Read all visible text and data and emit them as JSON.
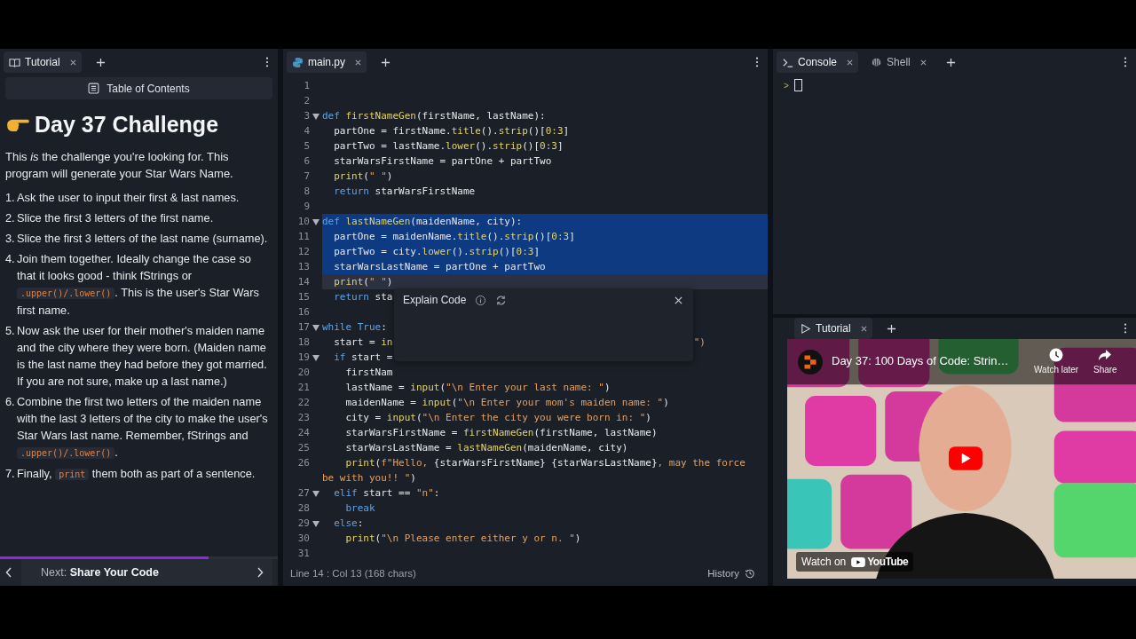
{
  "tutorial_pane": {
    "tab": {
      "label": "Tutorial",
      "selected": true
    },
    "toc_button": "Table of Contents",
    "heading": "Day 37 Challenge",
    "intro": "This *is* the challenge you're looking for. This program will generate your Star Wars Name.",
    "steps": [
      {
        "number": "1.",
        "parts": [
          {
            "kind": "text",
            "text": "Ask the user to input their first & last names."
          }
        ]
      },
      {
        "number": "2.",
        "parts": [
          {
            "kind": "text",
            "text": "Slice the first 3 letters of the first name."
          }
        ]
      },
      {
        "number": "3.",
        "parts": [
          {
            "kind": "text",
            "text": "Slice the first 3 letters of the last name (surname)."
          }
        ]
      },
      {
        "number": "4.",
        "parts": [
          {
            "kind": "text",
            "text": "Join them together. Ideally change the case so that it looks good - think fStrings or "
          },
          {
            "kind": "code",
            "text": ".upper()/.lower()"
          },
          {
            "kind": "text",
            "text": ". This is the user's Star Wars first name."
          }
        ]
      },
      {
        "number": "5.",
        "parts": [
          {
            "kind": "text",
            "text": "Now ask the user for their mother's maiden name and the city where they were born. (Maiden name is the last name they had before they got married. If you are not sure, make up a last name.)"
          }
        ]
      },
      {
        "number": "6.",
        "parts": [
          {
            "kind": "text",
            "text": "Combine the first two letters of the maiden name with the last 3 letters of the city to make the user's Star Wars last name. Remember, fStrings and "
          },
          {
            "kind": "code",
            "text": ".upper()/.lower()"
          },
          {
            "kind": "text",
            "text": "."
          }
        ]
      },
      {
        "number": "7.",
        "parts": [
          {
            "kind": "text",
            "text": "Finally, "
          },
          {
            "kind": "code",
            "text": "print"
          },
          {
            "kind": "text",
            "text": " them both as part of a sentence."
          }
        ]
      }
    ],
    "progress": {
      "level": 0.75
    },
    "next": {
      "prefix": "Next:",
      "title": "Share Your Code"
    }
  },
  "editor": {
    "tab": {
      "label": "main.py",
      "selected": true
    },
    "lines": [
      {
        "number": "1"
      },
      {
        "number": "2"
      },
      {
        "number": "3",
        "fold": true,
        "selected": false,
        "current": false,
        "tokens": [
          {
            "kind": "kw",
            "text": "def"
          },
          {
            "kind": "fn",
            "text": " firstNameGen"
          },
          {
            "kind": "plain",
            "text": "(firstName, lastName):"
          }
        ]
      },
      {
        "number": "4",
        "fold": false,
        "selected": false,
        "current": false,
        "tokens": [
          {
            "kind": "plain",
            "text": "  partOne = firstName."
          },
          {
            "kind": "fn",
            "text": "title"
          },
          {
            "kind": "plain",
            "text": "()."
          },
          {
            "kind": "fn",
            "text": "strip"
          },
          {
            "kind": "plain",
            "text": "()["
          },
          {
            "kind": "num",
            "text": "0:3"
          },
          {
            "kind": "plain",
            "text": "]"
          }
        ]
      },
      {
        "number": "5",
        "fold": false,
        "selected": false,
        "current": false,
        "tokens": [
          {
            "kind": "plain",
            "text": "  partTwo = lastName."
          },
          {
            "kind": "fn",
            "text": "lower"
          },
          {
            "kind": "plain",
            "text": "()."
          },
          {
            "kind": "fn",
            "text": "strip"
          },
          {
            "kind": "plain",
            "text": "()["
          },
          {
            "kind": "num",
            "text": "0:3"
          },
          {
            "kind": "plain",
            "text": "]"
          }
        ]
      },
      {
        "number": "6",
        "fold": false,
        "selected": false,
        "current": false,
        "tokens": [
          {
            "kind": "plain",
            "text": "  starWarsFirstName = partOne + partTwo"
          }
        ]
      },
      {
        "number": "7",
        "fold": false,
        "selected": false,
        "current": false,
        "tokens": [
          {
            "kind": "fn",
            "text": "  print"
          },
          {
            "kind": "plain",
            "text": "("
          },
          {
            "kind": "str",
            "text": "\" \""
          },
          {
            "kind": "plain",
            "text": ")"
          }
        ]
      },
      {
        "number": "8",
        "fold": false,
        "selected": false,
        "current": false,
        "tokens": [
          {
            "kind": "kw",
            "text": "  return"
          },
          {
            "kind": "plain",
            "text": " starWarsFirstName"
          }
        ]
      },
      {
        "number": "9"
      },
      {
        "number": "10",
        "fold": true,
        "selected": true,
        "current": false,
        "tokens": [
          {
            "kind": "kw",
            "text": "def"
          },
          {
            "kind": "fn",
            "text": " lastNameGen"
          },
          {
            "kind": "plain",
            "text": "(maidenName, city):"
          }
        ]
      },
      {
        "number": "11",
        "fold": false,
        "selected": true,
        "current": false,
        "tokens": [
          {
            "kind": "plain",
            "text": "  partOne = maidenName."
          },
          {
            "kind": "fn",
            "text": "title"
          },
          {
            "kind": "plain",
            "text": "()."
          },
          {
            "kind": "fn",
            "text": "strip"
          },
          {
            "kind": "plain",
            "text": "()["
          },
          {
            "kind": "num",
            "text": "0:3"
          },
          {
            "kind": "plain",
            "text": "]"
          }
        ]
      },
      {
        "number": "12",
        "fold": false,
        "selected": true,
        "current": false,
        "tokens": [
          {
            "kind": "plain",
            "text": "  partTwo = city."
          },
          {
            "kind": "fn",
            "text": "lower"
          },
          {
            "kind": "plain",
            "text": "()."
          },
          {
            "kind": "fn",
            "text": "strip"
          },
          {
            "kind": "plain",
            "text": "()["
          },
          {
            "kind": "num",
            "text": "0:3"
          },
          {
            "kind": "plain",
            "text": "]"
          }
        ]
      },
      {
        "number": "13",
        "fold": false,
        "selected": true,
        "current": false,
        "tokens": [
          {
            "kind": "plain",
            "text": "  starWarsLastName = partOne + partTwo"
          }
        ]
      },
      {
        "number": "14",
        "fold": false,
        "selected": false,
        "current": true,
        "tokens": [
          {
            "kind": "fn",
            "text": "  print"
          },
          {
            "kind": "plain",
            "text": "("
          },
          {
            "kind": "str",
            "text": "\" \""
          },
          {
            "kind": "plain",
            "text": ")"
          }
        ]
      },
      {
        "number": "15",
        "fold": false,
        "selected": false,
        "current": false,
        "tokens": [
          {
            "kind": "kw",
            "text": "  return"
          },
          {
            "kind": "plain",
            "text": " sta"
          }
        ]
      },
      {
        "number": "16"
      },
      {
        "number": "17",
        "fold": true,
        "selected": false,
        "current": false,
        "tokens": [
          {
            "kind": "kw",
            "text": "while"
          },
          {
            "kind": "kw",
            "text": " True"
          },
          {
            "kind": "plain",
            "text": ":"
          }
        ]
      },
      {
        "number": "18",
        "fold": false,
        "selected": false,
        "current": false,
        "tokens": [
          {
            "kind": "plain",
            "text": "  start = "
          },
          {
            "kind": "fn",
            "text": "in"
          }
        ],
        "tail": "\")"
      },
      {
        "number": "19",
        "fold": true,
        "selected": false,
        "current": false,
        "tokens": [
          {
            "kind": "kw",
            "text": "  if"
          },
          {
            "kind": "plain",
            "text": " start ="
          }
        ]
      },
      {
        "number": "20",
        "fold": false,
        "selected": false,
        "current": false,
        "tokens": [
          {
            "kind": "plain",
            "text": "    firstNam"
          }
        ]
      },
      {
        "number": "21",
        "fold": false,
        "selected": false,
        "current": false,
        "tokens": [
          {
            "kind": "plain",
            "text": "    lastName = "
          },
          {
            "kind": "fn",
            "text": "input"
          },
          {
            "kind": "plain",
            "text": "("
          },
          {
            "kind": "str",
            "text": "\"\\n Enter your last name: \""
          },
          {
            "kind": "plain",
            "text": ")"
          }
        ]
      },
      {
        "number": "22",
        "fold": false,
        "selected": false,
        "current": false,
        "tokens": [
          {
            "kind": "plain",
            "text": "    maidenName = "
          },
          {
            "kind": "fn",
            "text": "input"
          },
          {
            "kind": "plain",
            "text": "("
          },
          {
            "kind": "str",
            "text": "\"\\n Enter your mom's maiden name: \""
          },
          {
            "kind": "plain",
            "text": ")"
          }
        ]
      },
      {
        "number": "23",
        "fold": false,
        "selected": false,
        "current": false,
        "tokens": [
          {
            "kind": "plain",
            "text": "    city = "
          },
          {
            "kind": "fn",
            "text": "input"
          },
          {
            "kind": "plain",
            "text": "("
          },
          {
            "kind": "str",
            "text": "\"\\n Enter the city you were born in: \""
          },
          {
            "kind": "plain",
            "text": ")"
          }
        ]
      },
      {
        "number": "24",
        "fold": false,
        "selected": false,
        "current": false,
        "tokens": [
          {
            "kind": "plain",
            "text": "    starWarsFirstName = "
          },
          {
            "kind": "fn",
            "text": "firstNameGen"
          },
          {
            "kind": "plain",
            "text": "(firstName, lastName)"
          }
        ]
      },
      {
        "number": "25",
        "fold": false,
        "selected": false,
        "current": false,
        "tokens": [
          {
            "kind": "plain",
            "text": "    starWarsLastName = "
          },
          {
            "kind": "fn",
            "text": "lastNameGen"
          },
          {
            "kind": "plain",
            "text": "(maidenName, city)"
          }
        ]
      },
      {
        "number": "26",
        "fold": false,
        "selected": false,
        "current": false,
        "tokens": [
          {
            "kind": "fn",
            "text": "    print"
          },
          {
            "kind": "plain",
            "text": "("
          },
          {
            "kind": "str",
            "text": "f\"Hello, "
          },
          {
            "kind": "plain",
            "text": "{starWarsFirstName} {starWarsLastName}"
          },
          {
            "kind": "str",
            "text": ", may the force"
          }
        ],
        "wrap": [
          {
            "kind": "str",
            "text": "be with you!! \""
          },
          {
            "kind": "plain",
            "text": ")"
          }
        ]
      },
      {
        "number": "27",
        "fold": true,
        "selected": false,
        "current": false,
        "tokens": [
          {
            "kind": "kw",
            "text": "  elif"
          },
          {
            "kind": "plain",
            "text": " start == "
          },
          {
            "kind": "str",
            "text": "\"n\""
          },
          {
            "kind": "plain",
            "text": ":"
          }
        ]
      },
      {
        "number": "28",
        "fold": false,
        "selected": false,
        "current": false,
        "tokens": [
          {
            "kind": "kw",
            "text": "    break"
          }
        ]
      },
      {
        "number": "29",
        "fold": true,
        "selected": false,
        "current": false,
        "tokens": [
          {
            "kind": "kw",
            "text": "  else"
          },
          {
            "kind": "plain",
            "text": ":"
          }
        ]
      },
      {
        "number": "30",
        "fold": false,
        "selected": false,
        "current": false,
        "tokens": [
          {
            "kind": "fn",
            "text": "    print"
          },
          {
            "kind": "plain",
            "text": "("
          },
          {
            "kind": "str",
            "text": "\"\\n Please enter either y or n. \""
          },
          {
            "kind": "plain",
            "text": ")"
          }
        ]
      },
      {
        "number": "31"
      }
    ],
    "status": "Line 14 : Col 13 (168 chars)",
    "history_button": "History"
  },
  "explain_popup": {
    "title": "Explain Code"
  },
  "console_pane": {
    "tabs": [
      {
        "label": "Console",
        "selected": true,
        "kind": "console"
      },
      {
        "label": "Shell",
        "selected": false,
        "kind": "shell"
      }
    ],
    "prompt": ">"
  },
  "video_pane": {
    "tab": {
      "label": "Tutorial",
      "selected": true
    },
    "video": {
      "kind": "picture",
      "title": "Day 37: 100 Days of Code: Strin…",
      "watch_later": "Watch later",
      "share": "Share",
      "watch_on": "Watch on",
      "youtube": "YouTube"
    }
  }
}
